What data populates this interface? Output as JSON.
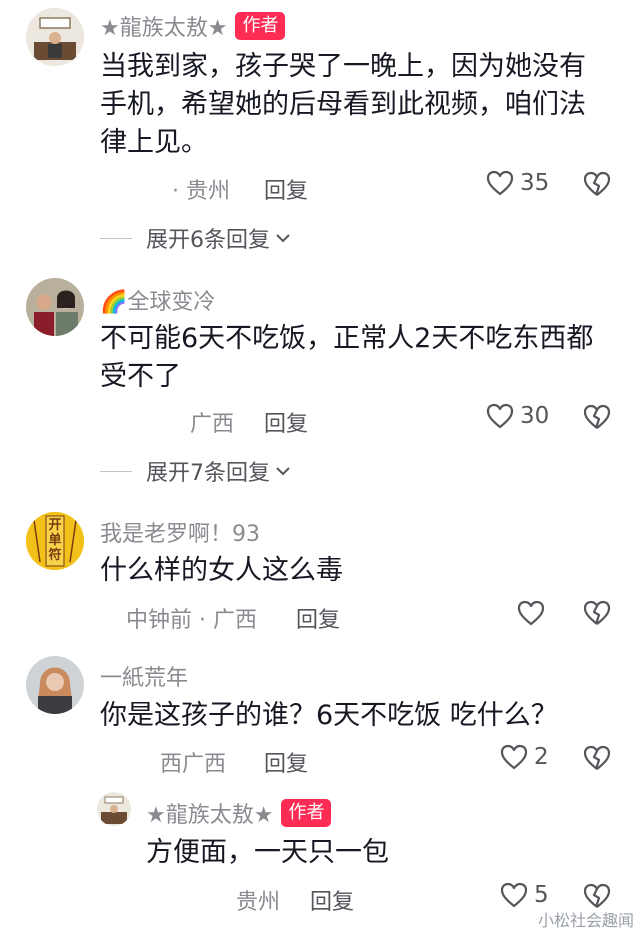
{
  "comments": [
    {
      "username": "★龍族太敖★",
      "badge": "作者",
      "text": "当我到家，孩子哭了一晚上，因为她没有手机，希望她的后母看到此视频，咱们法律上见。",
      "meta": "· 贵州",
      "reply_label": "回复",
      "likes": "35",
      "expand_label": "展开6条回复"
    },
    {
      "username": "🌈全球变冷",
      "text": "不可能6天不吃饭，正常人2天不吃东西都受不了",
      "meta": "广西",
      "reply_label": "回复",
      "likes": "30",
      "expand_label": "展开7条回复"
    },
    {
      "username": "我是老罗啊！93",
      "text": "什么样的女人这么毒",
      "meta": "中钟前 · 广西",
      "reply_label": "回复",
      "likes": ""
    },
    {
      "username": "一紙荒年",
      "text": "你是这孩子的谁？6天不吃饭 吃什么？",
      "meta": "西广西",
      "reply_label": "回复",
      "likes": "2"
    }
  ],
  "reply": {
    "username": "★龍族太敖★",
    "badge": "作者",
    "text": "方便面，一天只一包",
    "meta": "贵州",
    "reply_label": "回复",
    "likes": "5"
  },
  "watermark": "小松社会趣闻",
  "avatar3_text": "开单符",
  "colors": {
    "accent": "#fe2c55",
    "secondary_text": "#8a8b91"
  }
}
